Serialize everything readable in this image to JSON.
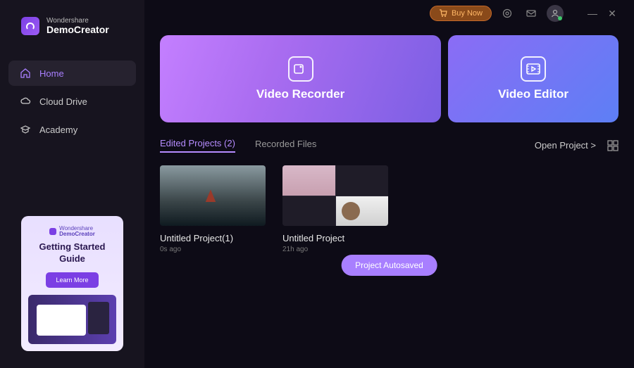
{
  "brand": {
    "sub": "Wondershare",
    "main": "DemoCreator"
  },
  "titlebar": {
    "buy": "Buy Now"
  },
  "sidebar": {
    "items": [
      {
        "label": "Home"
      },
      {
        "label": "Cloud Drive"
      },
      {
        "label": "Academy"
      }
    ]
  },
  "promo": {
    "logo_sub": "Wondershare",
    "logo_main": "DemoCreator",
    "title": "Getting Started Guide",
    "button": "Learn More"
  },
  "hero": {
    "recorder": "Video Recorder",
    "editor": "Video Editor"
  },
  "tabs": {
    "edited": "Edited Projects (2)",
    "recorded": "Recorded Files",
    "open": "Open Project >"
  },
  "projects": [
    {
      "title": "Untitled Project(1)",
      "time": "0s ago"
    },
    {
      "title": "Untitled Project",
      "time": "21h ago"
    }
  ],
  "toast": "Project Autosaved"
}
